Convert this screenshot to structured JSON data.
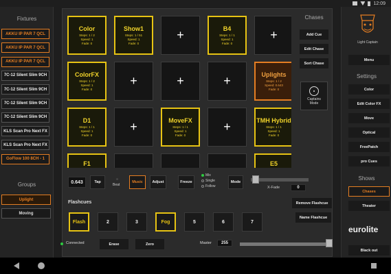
{
  "statusbar": {
    "time": "12:09"
  },
  "fixtures": {
    "title": "Fixtures",
    "items": [
      {
        "label": "AKKU IP PAR 7 QCL",
        "active": true
      },
      {
        "label": "AKKU IP PAR 7 QCL",
        "active": true
      },
      {
        "label": "AKKU IP PAR 7 QCL",
        "active": true
      },
      {
        "label": "7C-12 Silent Slim 9CH",
        "active": false
      },
      {
        "label": "7C-12 Silent Slim 9CH",
        "active": false
      },
      {
        "label": "7C-12 Silent Slim 9CH",
        "active": false
      },
      {
        "label": "7C-12 Silent Slim 9CH",
        "active": false
      },
      {
        "label": "KLS Scan Pro Next FX",
        "active": false
      },
      {
        "label": "KLS Scan Pro Next FX",
        "active": false
      },
      {
        "label": "GoFlow 100 8CH - 1",
        "active": true
      }
    ]
  },
  "groups": {
    "title": "Groups",
    "items": [
      {
        "label": "Uplight",
        "active": true
      },
      {
        "label": "Moving",
        "active": false
      }
    ]
  },
  "pads": [
    {
      "name": "Color",
      "steps": "Steps: 1 / 2",
      "speed": "Speed: 1",
      "fade": "Fade: 0",
      "state": "yellow"
    },
    {
      "name": "Show1",
      "steps": "Steps: 1 / 51",
      "speed": "Speed: 1",
      "fade": "Fade: 0",
      "state": "yellow"
    },
    {
      "name": "+",
      "state": "empty"
    },
    {
      "name": "B4",
      "steps": "Steps: 1 / 1",
      "speed": "Speed: 1",
      "fade": "Fade: 0",
      "state": "yellow"
    },
    {
      "name": "+",
      "state": "empty"
    },
    {
      "name": "ColorFX",
      "steps": "Steps: 1 / 2",
      "speed": "Speed: 1",
      "fade": "Fade: 0",
      "state": "yellow"
    },
    {
      "name": "+",
      "state": "empty"
    },
    {
      "name": "+",
      "state": "empty"
    },
    {
      "name": "+",
      "state": "empty"
    },
    {
      "name": "Uplights",
      "steps": "Steps: 1 / 2",
      "speed": "Speed: 0.643",
      "fade": "Fade: 0",
      "state": "orange"
    },
    {
      "name": "D1",
      "steps": "Steps: 1 / 1",
      "speed": "Speed: 1",
      "fade": "Fade: 0",
      "state": "yellow"
    },
    {
      "name": "+",
      "state": "empty"
    },
    {
      "name": "MoveFX",
      "steps": "Steps: 1 / 1",
      "speed": "Speed: 1",
      "fade": "Fade: 0",
      "state": "yellow"
    },
    {
      "name": "+",
      "state": "empty"
    },
    {
      "name": "TMH Hybrid",
      "steps": "Steps: 1 / 1",
      "speed": "Speed: 1",
      "fade": "Fade: 0",
      "state": "yellow"
    },
    {
      "name": "F1",
      "state": "yellow-partial"
    },
    {
      "name": "",
      "state": "empty-partial"
    },
    {
      "name": "",
      "state": "empty-partial"
    },
    {
      "name": "",
      "state": "empty-partial"
    },
    {
      "name": "E5",
      "state": "yellow-partial"
    }
  ],
  "chases": {
    "title": "Chases",
    "add_cue": "Add Cue",
    "edit_chase": "Edit Chase",
    "sort_chase": "Sort Chase",
    "captains_mode": "Captains Mode"
  },
  "controls": {
    "speed_value": "0.643",
    "tap": "Tap",
    "beat": "Beat",
    "music": "Music",
    "adjust": "Adjust",
    "freeze": "Freeze",
    "mix": "Mix",
    "single": "Single",
    "follow": "Follow",
    "mode": "Mode",
    "xfade_label": "X-Fade",
    "xfade_value": "0"
  },
  "flashcues": {
    "title": "Flashcues",
    "items": [
      {
        "label": "Flash",
        "active": true
      },
      {
        "label": "2",
        "active": false
      },
      {
        "label": "3",
        "active": false
      },
      {
        "label": "Fog",
        "active": true
      },
      {
        "label": "5",
        "active": false
      },
      {
        "label": "6",
        "active": false
      },
      {
        "label": "7",
        "active": false
      }
    ],
    "remove": "Remove Flashcue",
    "name": "Name Flashcue"
  },
  "bottom": {
    "connected": "Connected",
    "erase": "Erase",
    "zero": "Zero",
    "master_label": "Master",
    "master_value": "255"
  },
  "right": {
    "logo_text": "Light Captain",
    "menu": "Menu",
    "settings_title": "Settings",
    "settings": [
      "Color",
      "Edit Color FX",
      "Move",
      "Optical",
      "FreePatch",
      "pro Cues"
    ],
    "shows_title": "Shows",
    "shows": [
      {
        "label": "Chases",
        "active": true
      },
      {
        "label": "Theater",
        "active": false
      }
    ],
    "brand": "eurolite",
    "blackout": "Black out"
  },
  "colors": {
    "accent_orange": "#e67e22",
    "accent_yellow": "#e8c413",
    "connected_green": "#2ecc40"
  }
}
